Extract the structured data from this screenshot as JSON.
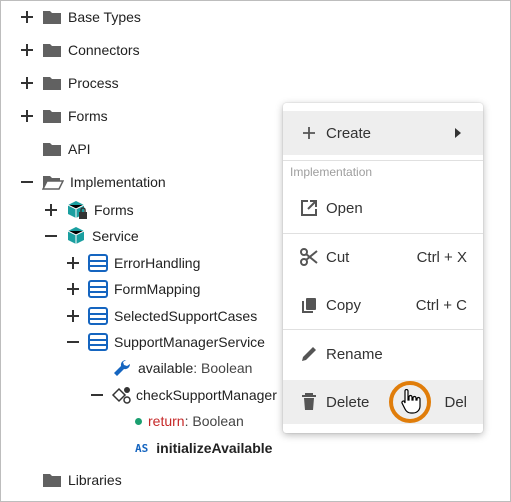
{
  "tree": {
    "items": [
      {
        "label": "Base Types"
      },
      {
        "label": "Connectors"
      },
      {
        "label": "Process"
      },
      {
        "label": "Forms"
      },
      {
        "label": "API"
      },
      {
        "label": "Implementation"
      },
      {
        "label": "Forms"
      },
      {
        "label": "Service"
      },
      {
        "label": "ErrorHandling"
      },
      {
        "label": "FormMapping"
      },
      {
        "label": "SelectedSupportCases"
      },
      {
        "label": "SupportManagerService"
      },
      {
        "label": "available",
        "type": ": Boolean"
      },
      {
        "label": "checkSupportManager"
      },
      {
        "label": "return",
        "type": ": Boolean"
      },
      {
        "label": "initializeAvailable",
        "badge": "AS"
      },
      {
        "label": "Libraries"
      }
    ]
  },
  "context_menu": {
    "create": "Create",
    "section": "Implementation",
    "open": "Open",
    "cut": "Cut",
    "cut_shortcut": "Ctrl + X",
    "copy": "Copy",
    "copy_shortcut": "Ctrl + C",
    "rename": "Rename",
    "delete": "Delete",
    "delete_shortcut": "Del"
  },
  "colors": {
    "folder": "#616161",
    "teal": "#1a9fa0",
    "blue": "#1565c0",
    "return_text": "#c62828",
    "highlight_ring": "#e07d0a"
  }
}
